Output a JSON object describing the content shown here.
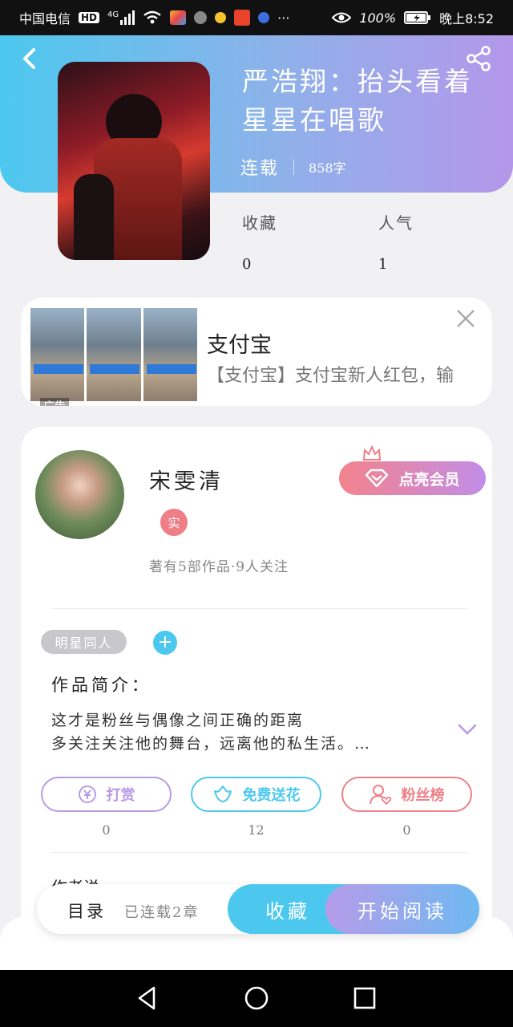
{
  "status_bar": {
    "carrier": "中国电信",
    "hd": "HD",
    "network": "4G",
    "more": "···",
    "battery_pct": "100%",
    "time": "晚上8:52"
  },
  "header": {
    "title": "严浩翔：抬头看着星星在唱歌",
    "status": "连载",
    "word_count": "858字",
    "stats": [
      {
        "label": "收藏",
        "value": "0"
      },
      {
        "label": "人气",
        "value": "1"
      }
    ]
  },
  "ad": {
    "title": "支付宝",
    "description": "【支付宝】支付宝新人红包，输",
    "badge": "广告"
  },
  "author": {
    "name": "宋雯清",
    "verified_label": "实",
    "meta": "著有5部作品·9人关注",
    "vip_button": "点亮会员"
  },
  "tags": {
    "chip": "明星同人",
    "add": "+"
  },
  "intro": {
    "heading": "作品简介：",
    "lines": [
      "这才是粉丝与偶像之间正确的距离",
      "多关注关注他的舞台，远离他的私生活。…"
    ]
  },
  "actions": [
    {
      "label": "打赏",
      "count": "0",
      "color": "#b79be6"
    },
    {
      "label": "免费送花",
      "count": "12",
      "color": "#4cc8ef"
    },
    {
      "label": "粉丝榜",
      "count": "0",
      "color": "#f07e86"
    }
  ],
  "bottom_bar": {
    "toc": "目录",
    "chapters": "已连载2章",
    "collect": "收藏",
    "read": "开始阅读"
  },
  "peek_text": "作者说"
}
